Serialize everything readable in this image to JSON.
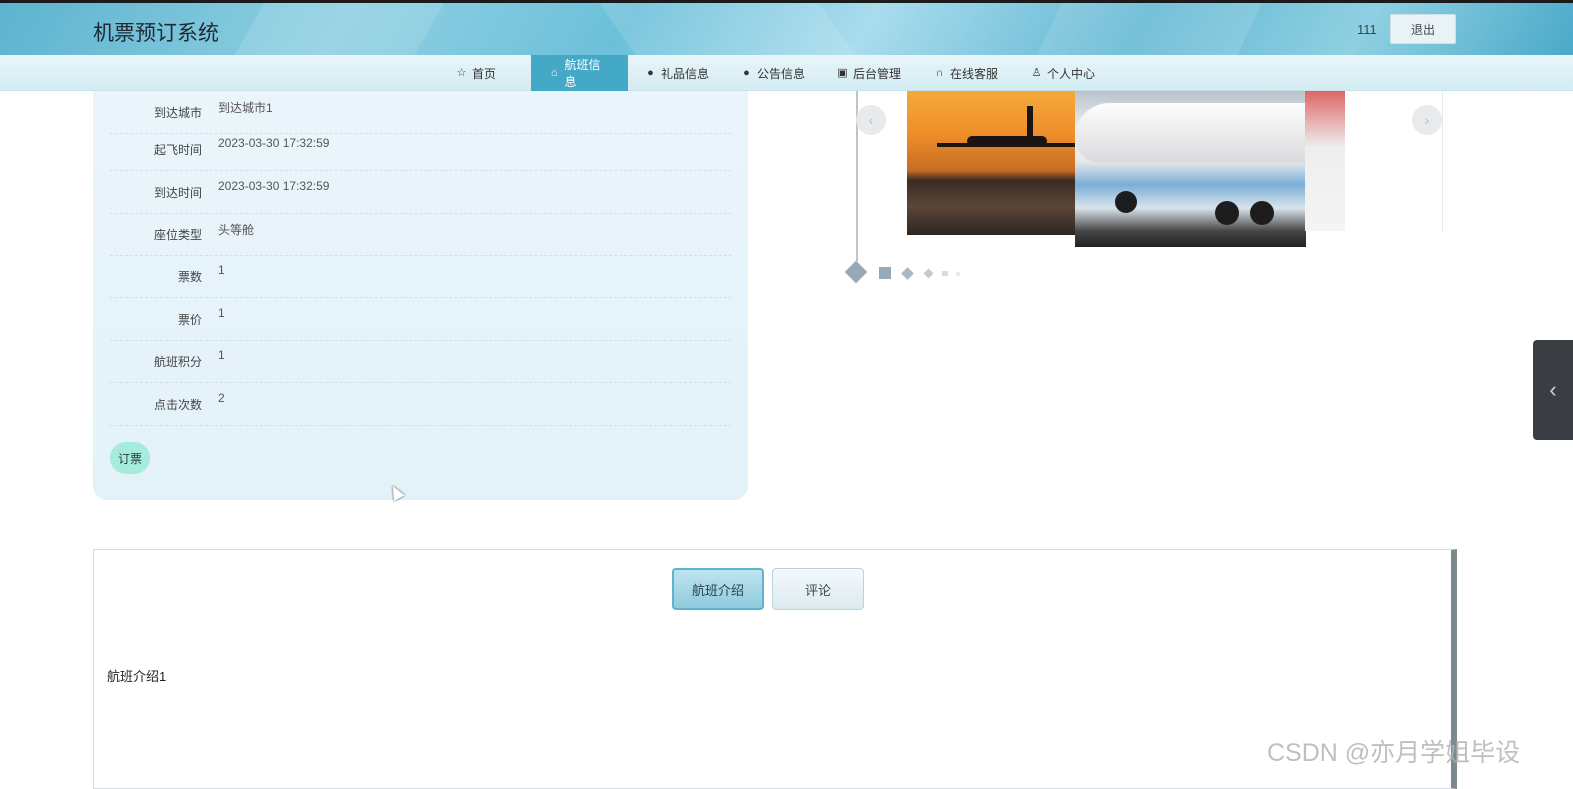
{
  "header": {
    "site_title": "机票预订系统",
    "user_name": "111",
    "logout_label": "退出"
  },
  "nav": {
    "items": [
      {
        "label": "首页",
        "icon": "star-icon",
        "active": false
      },
      {
        "label": "航班信息",
        "icon": "bag-icon",
        "active": true
      },
      {
        "label": "礼品信息",
        "icon": "info-circle-icon",
        "active": false
      },
      {
        "label": "公告信息",
        "icon": "question-circle-icon",
        "active": false
      },
      {
        "label": "后台管理",
        "icon": "building-icon",
        "active": false
      },
      {
        "label": "在线客服",
        "icon": "headset-icon",
        "active": false
      },
      {
        "label": "个人中心",
        "icon": "user-icon",
        "active": false
      }
    ]
  },
  "detail": {
    "rows": [
      {
        "label": "到达城市",
        "value": "到达城市1"
      },
      {
        "label": "起飞时间",
        "value": "2023-03-30 17:32:59"
      },
      {
        "label": "到达时间",
        "value": "2023-03-30 17:32:59"
      },
      {
        "label": "座位类型",
        "value": "头等舱"
      },
      {
        "label": "票数",
        "value": "1"
      },
      {
        "label": "票价",
        "value": "1"
      },
      {
        "label": "航班积分",
        "value": "1"
      },
      {
        "label": "点击次数",
        "value": "2"
      }
    ],
    "order_label": "订票"
  },
  "carousel": {
    "prev_icon": "chevron-left-icon",
    "next_icon": "chevron-right-icon"
  },
  "side_tab": {
    "icon": "chevron-left-icon"
  },
  "tabs": {
    "items": [
      {
        "label": "航班介绍",
        "active": true
      },
      {
        "label": "评论",
        "active": false
      }
    ],
    "content": "航班介绍1"
  },
  "watermark": "CSDN @亦月学姐毕设",
  "colors": {
    "accent": "#44a9c6",
    "order_button": "#a6ecdc"
  }
}
